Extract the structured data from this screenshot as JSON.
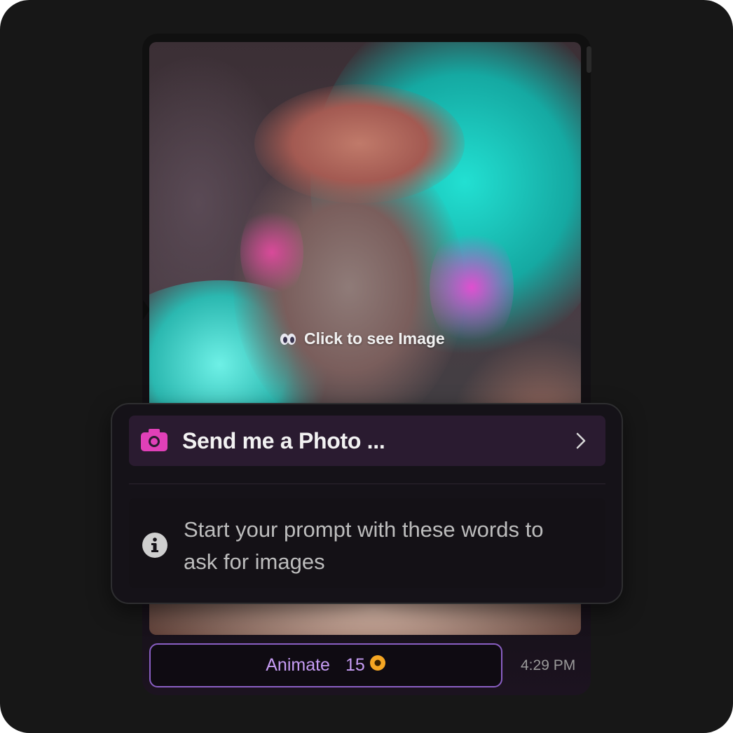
{
  "message": {
    "image_overlay_text": "Click to see Image",
    "timestamp": "4:29 PM"
  },
  "suggestion_popup": {
    "command_label": "Send me a Photo ...",
    "hint_text": "Start your prompt with these words to ask for images"
  },
  "animate_button": {
    "label": "Animate",
    "cost": "15"
  },
  "colors": {
    "accent_purple": "#c69cf4",
    "camera_pink": "#e040b8",
    "coin_gold": "#f5a623"
  },
  "icons": [
    "eyes-icon",
    "camera-icon",
    "chevron-right-icon",
    "info-icon",
    "coin-icon"
  ]
}
